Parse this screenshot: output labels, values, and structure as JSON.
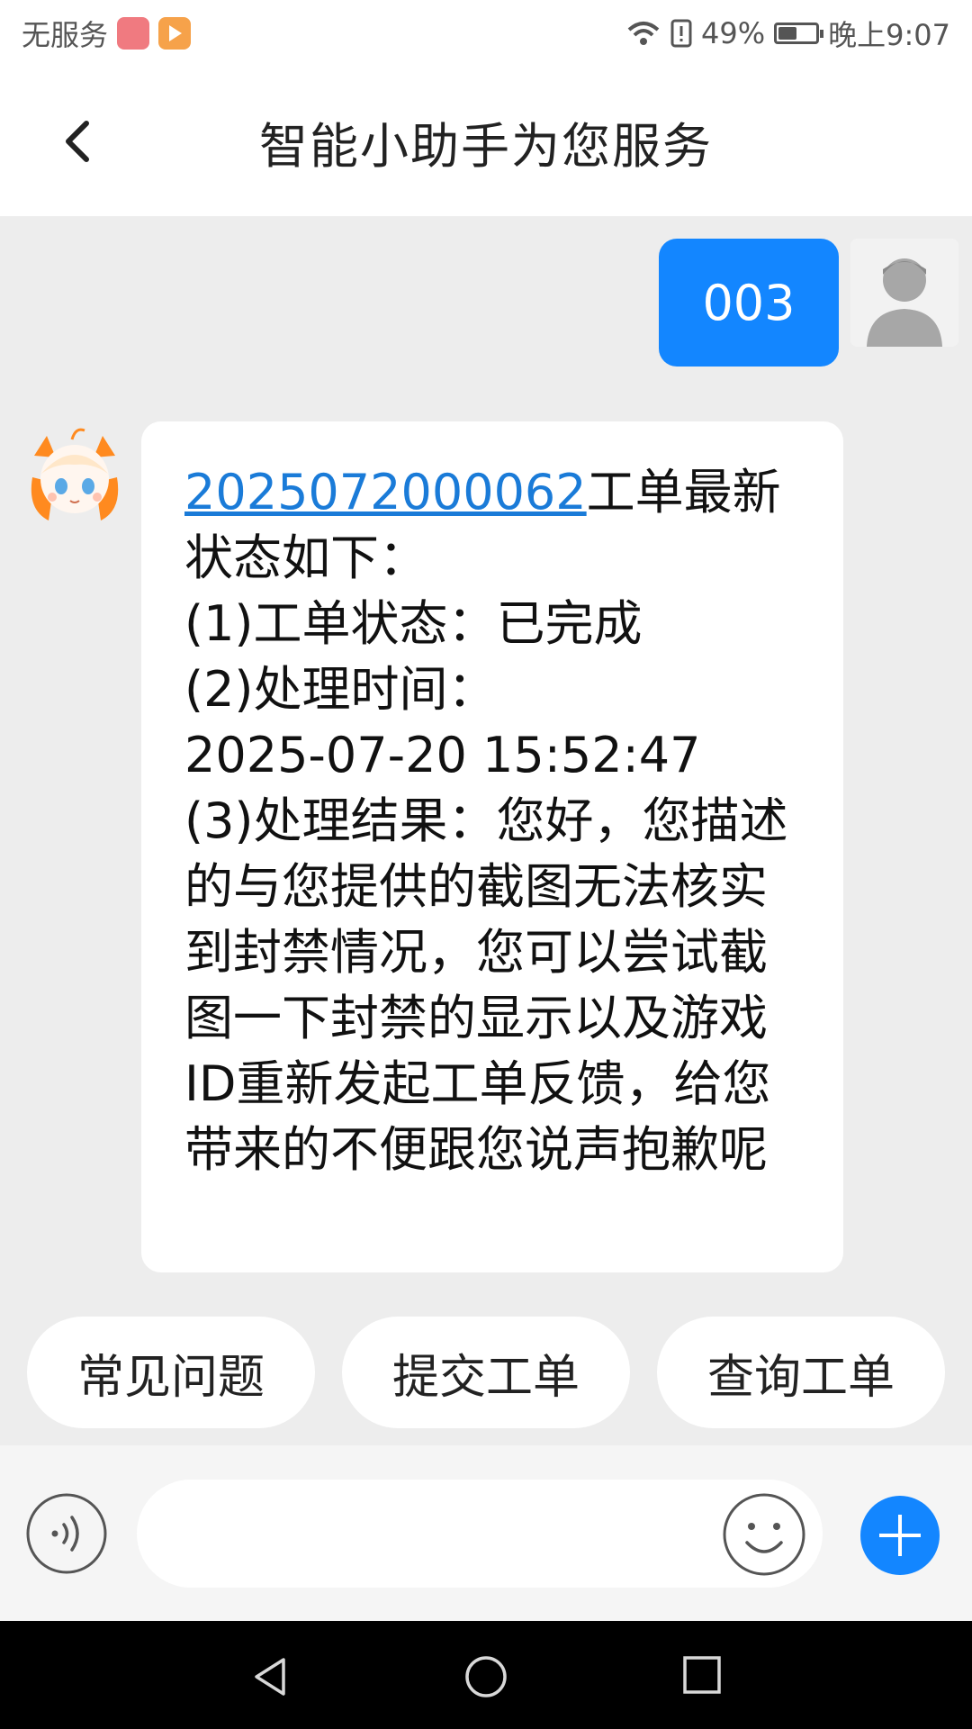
{
  "status_bar": {
    "carrier": "无服务",
    "battery": "49%",
    "time": "晚上9:07"
  },
  "header": {
    "title": "智能小助手为您服务"
  },
  "messages": {
    "user_message": "003",
    "bot_reply": {
      "ticket_id": "2025072000062",
      "line1_rest": "工单最新状态如下：",
      "status_line": "(1)工单状态：已完成",
      "time_label": "(2)处理时间：",
      "time_value": "2025-07-20 15:52:47",
      "result_text": "(3)处理结果：您好，您描述的与您提供的截图无法核实到封禁情况，您可以尝试截图一下封禁的显示以及游戏ID重新发起工单反馈，给您带来的不便跟您说声抱歉呢"
    }
  },
  "quick_replies": [
    "常见问题",
    "提交工单",
    "查询工单"
  ],
  "input": {
    "value": "",
    "placeholder": ""
  },
  "colors": {
    "accent": "#1386ff",
    "link": "#1a7bd8",
    "background": "#ededed"
  },
  "icons": [
    "back-icon",
    "voice-icon",
    "emoji-icon",
    "plus-icon",
    "user-avatar",
    "bot-avatar"
  ]
}
